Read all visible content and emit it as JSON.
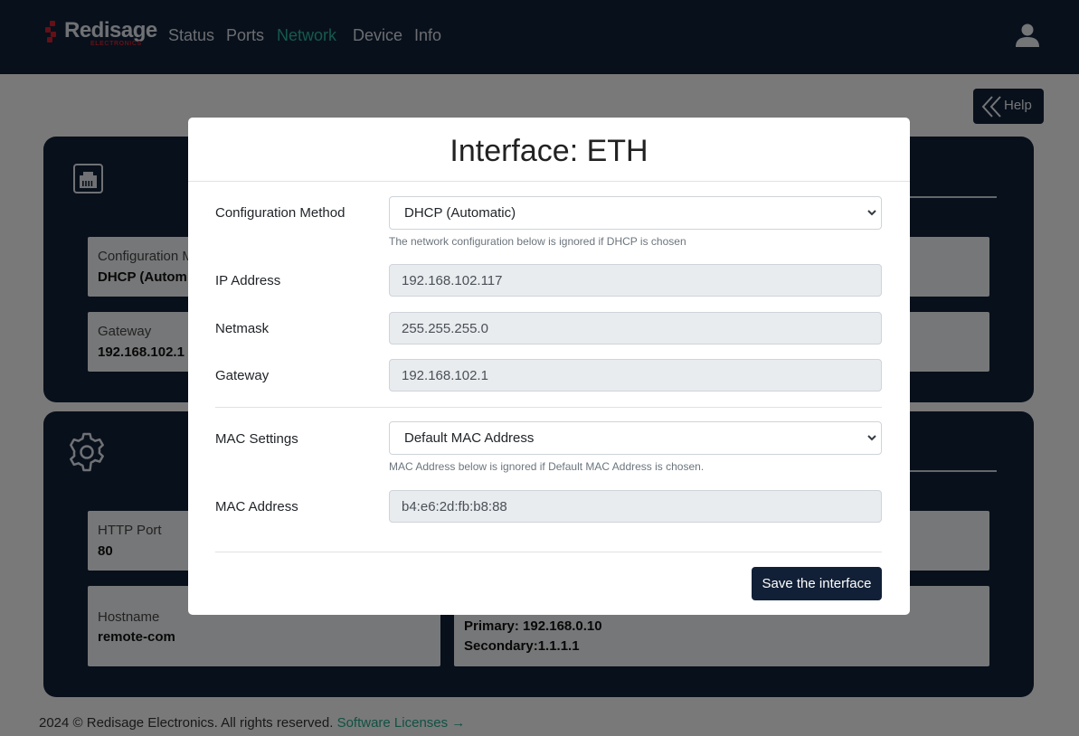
{
  "header": {
    "brand": "Redisage",
    "brand_sub": "ELECTRONICS",
    "nav": [
      "Status",
      "Ports",
      "Network",
      "Device",
      "Info"
    ],
    "active_nav": "Network",
    "user_icon": "user-icon"
  },
  "background": {
    "help_label": "Help",
    "interface_card": {
      "icon": "ethernet-port-icon",
      "tiles": [
        {
          "label": "Configuration M",
          "value": "DHCP (Autom"
        },
        {
          "label": "Gateway",
          "value": "192.168.102.1"
        }
      ]
    },
    "device_card": {
      "icon": "gear-icon",
      "tiles": [
        {
          "label": "HTTP Port",
          "value": "80"
        },
        {
          "label": "Hostname",
          "value": "remote-com"
        }
      ],
      "dns": {
        "primary": "Primary: 192.168.0.10",
        "secondary": "Secondary:1.1.1.1"
      }
    },
    "footer": {
      "text": "2024 © Redisage Electronics. All rights reserved.",
      "link": "Software Licenses →"
    }
  },
  "modal": {
    "title": "Interface: ETH",
    "config_method": {
      "label": "Configuration Method",
      "value": "DHCP (Automatic)",
      "hint": "The network configuration below is ignored if DHCP is chosen"
    },
    "ip": {
      "label": "IP Address",
      "value": "192.168.102.117"
    },
    "netmask": {
      "label": "Netmask",
      "value": "255.255.255.0"
    },
    "gateway": {
      "label": "Gateway",
      "value": "192.168.102.1"
    },
    "mac_settings": {
      "label": "MAC Settings",
      "value": "Default MAC Address",
      "hint": "MAC Address below is ignored if Default MAC Address is chosen."
    },
    "mac_address": {
      "label": "MAC Address",
      "value": "b4:e6:2d:fb:b8:88"
    },
    "save_label": "Save the interface"
  },
  "colors": {
    "navy": "#112036",
    "accent": "#2bb39a",
    "brand_red": "#c8202e"
  }
}
